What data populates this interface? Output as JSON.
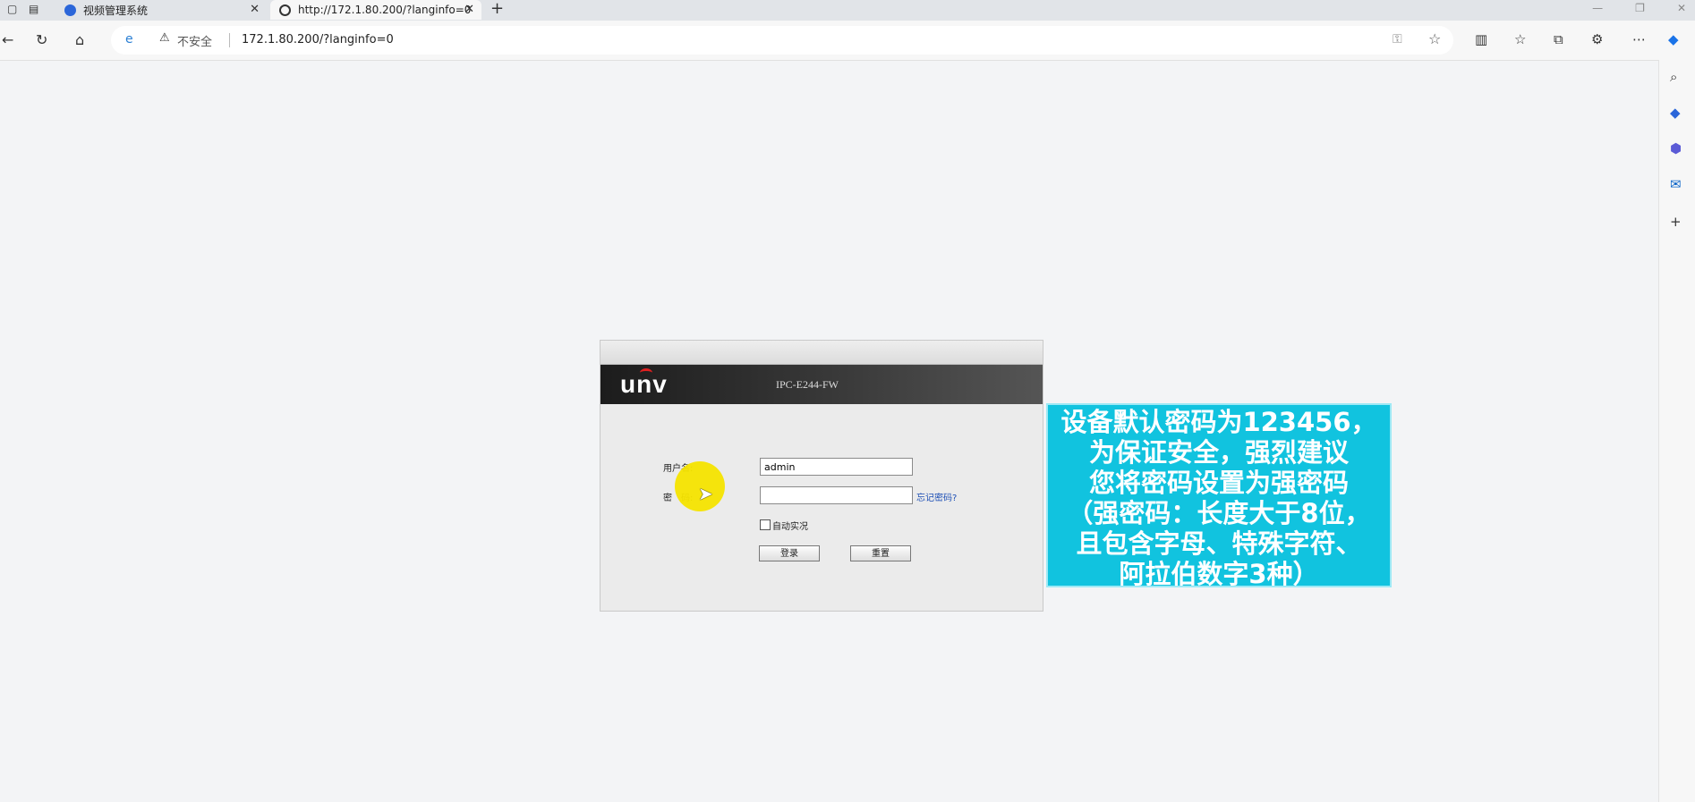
{
  "tabs": [
    {
      "title": "视频管理系统"
    },
    {
      "title": "http://172.1.80.200/?langinfo=0"
    }
  ],
  "new_tab_label": "+",
  "close_label": "✕",
  "address_bar": {
    "security_text": "不安全",
    "url": "172.1.80.200/?langinfo=0"
  },
  "login": {
    "logo_text": "unv",
    "model": "IPC-E244-FW",
    "username_label": "用户名:",
    "username_value": "admin",
    "password_label": "密　码:",
    "password_value": "",
    "forgot_link": "忘记密码?",
    "auto_login_label": "自动实况",
    "login_button": "登录",
    "reset_button": "重置"
  },
  "note": {
    "lines": [
      "设备默认密码为123456，",
      "为保证安全，强烈建议",
      "您将密码设置为强密码",
      "（强密码：长度大于8位，",
      "且包含字母、特殊字符、",
      "阿拉伯数字3种）"
    ]
  },
  "colors": {
    "note_bg": "#11c3df",
    "highlight": "#f6e400",
    "link": "#1d4fb5",
    "logo_arc": "#e02020"
  }
}
